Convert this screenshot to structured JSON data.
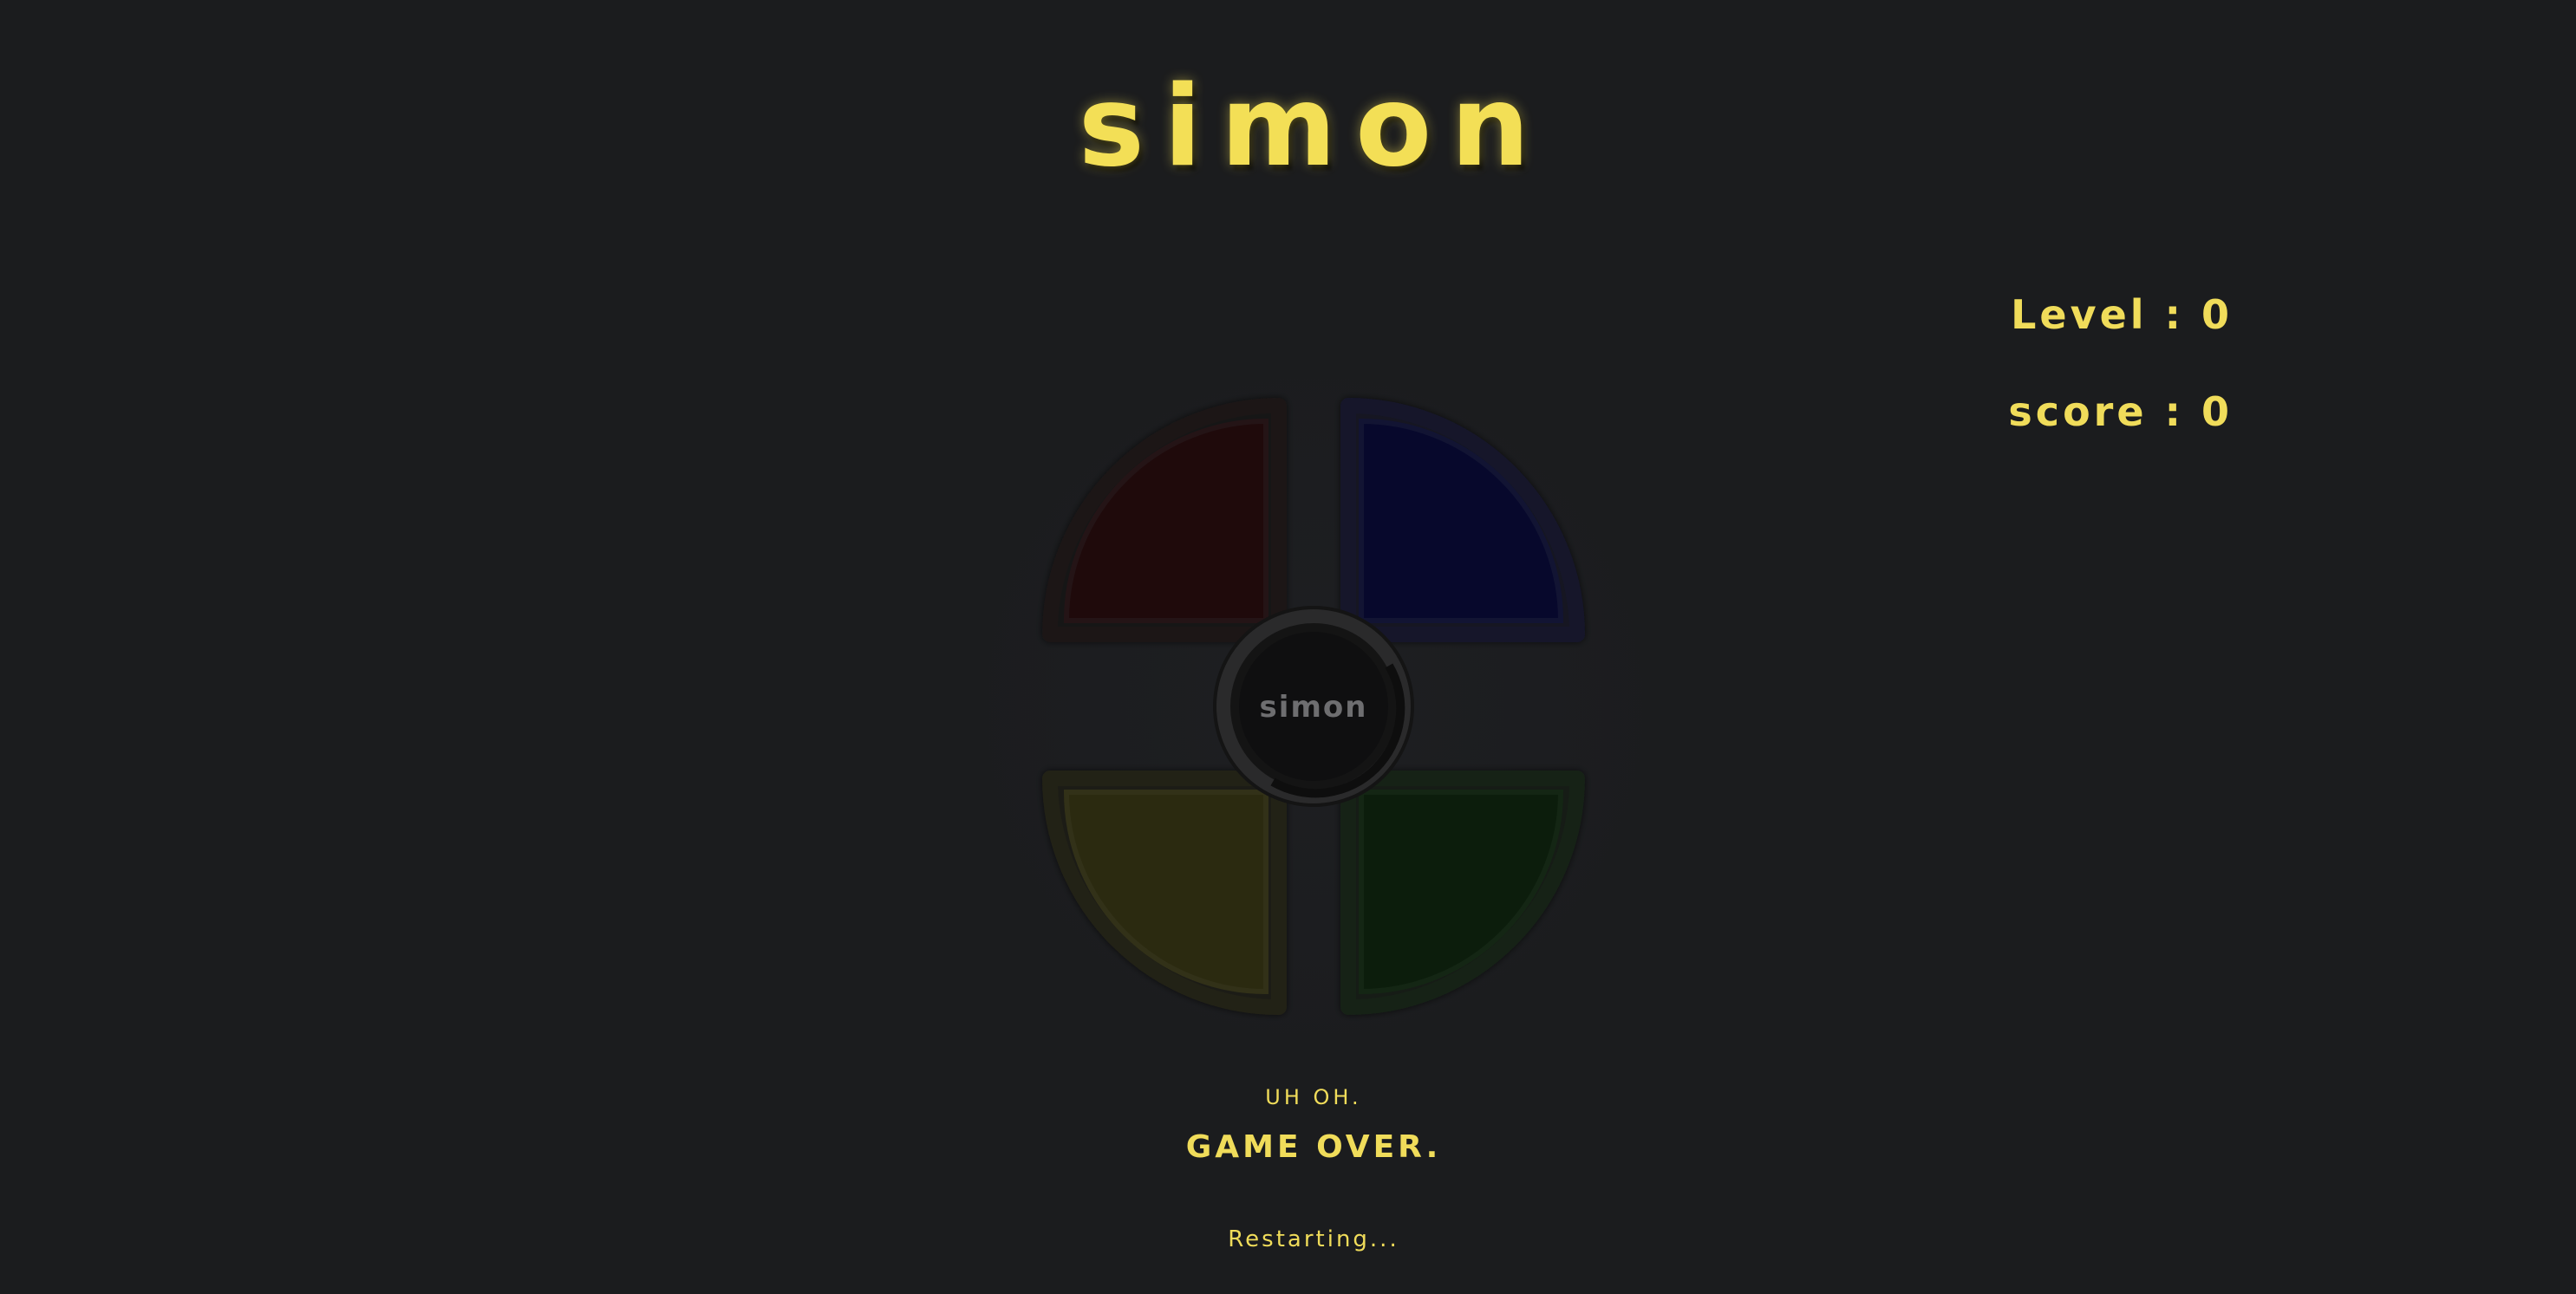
{
  "title": "simon",
  "stats": {
    "level_label": "Level : 0",
    "score_label": "score : 0"
  },
  "board": {
    "center_label": "simon",
    "pads": [
      {
        "name": "red",
        "color": "#1f0a0b"
      },
      {
        "name": "blue",
        "color": "#07082c"
      },
      {
        "name": "yellow",
        "color": "#2b2a10"
      },
      {
        "name": "green",
        "color": "#0c1d0c"
      }
    ]
  },
  "message": {
    "subtitle": "UH OH.",
    "headline": "GAME OVER.",
    "status": "Restarting..."
  },
  "colors": {
    "background": "#1b1c1e",
    "accent": "#f0dc5a"
  }
}
